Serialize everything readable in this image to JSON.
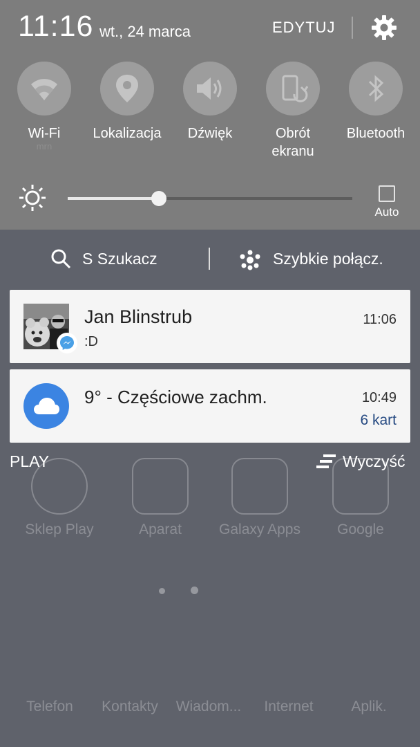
{
  "status": {
    "time": "11:16",
    "date": "wt., 24 marca",
    "edit_label": "EDYTUJ"
  },
  "quick_settings": [
    {
      "label": "Wi-Fi",
      "sub": "mrn",
      "icon": "wifi-icon"
    },
    {
      "label": "Lokalizacja",
      "icon": "location-icon"
    },
    {
      "label": "Dźwięk",
      "icon": "volume-icon"
    },
    {
      "label": "Obrót\nekranu",
      "icon": "rotate-icon"
    },
    {
      "label": "Bluetooth",
      "icon": "bluetooth-icon"
    }
  ],
  "brightness": {
    "level": 0.32,
    "auto_label": "Auto",
    "auto_checked": false
  },
  "search_row": {
    "search_label": "S Szukacz",
    "connect_label": "Szybkie połącz."
  },
  "notifications": [
    {
      "title": "Jan Blinstrub",
      "text": ":D",
      "time": "11:06",
      "app": "messenger"
    },
    {
      "title": "9° - Częściowe zachm.",
      "time": "10:49",
      "extra": "6 kart",
      "app": "weather"
    }
  ],
  "footer": {
    "app_label": "PLAY",
    "clear_label": "Wyczyść"
  },
  "home_screen": {
    "row1": [
      "Sklep Play",
      "Aparat",
      "Galaxy Apps",
      "Google"
    ],
    "row2": [
      "Telefon",
      "Kontakty",
      "Wiadom...",
      "Internet",
      "Aplik."
    ]
  },
  "colors": {
    "panel": "#7d7d7d",
    "card": "#f5f5f5",
    "weather_accent": "#3b84e2",
    "messenger_accent": "#4aa0e6"
  }
}
